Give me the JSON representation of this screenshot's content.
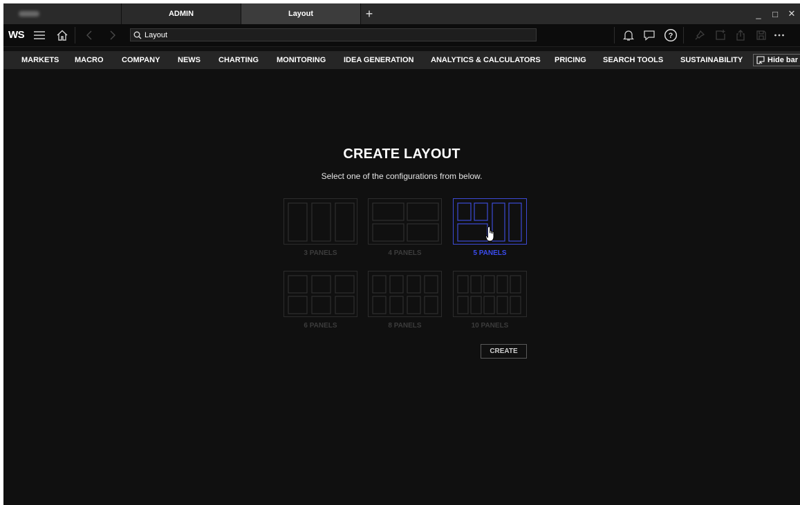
{
  "window": {
    "tabs": [
      {
        "label": ""
      },
      {
        "label": "ADMIN"
      },
      {
        "label": "Layout"
      }
    ],
    "new_tab_label": "+",
    "controls": {
      "minimize": "_",
      "maximize": "□",
      "close": "✕"
    }
  },
  "toolbar": {
    "logo": "WS",
    "icons": [
      "menu-icon",
      "home-icon",
      "back-icon",
      "forward-icon",
      "search-icon",
      "bell-icon",
      "chat-icon",
      "help-icon",
      "pin-icon",
      "new-window-icon",
      "export-icon",
      "save-icon",
      "more-icon"
    ],
    "search": {
      "value": "Layout",
      "placeholder": ""
    }
  },
  "menu": {
    "items": [
      "MARKETS",
      "MACRO",
      "COMPANY",
      "NEWS",
      "CHARTING",
      "MONITORING",
      "IDEA GENERATION",
      "ANALYTICS & CALCULATORS",
      "PRICING",
      "SEARCH TOOLS",
      "SUSTAINABILITY"
    ],
    "hide_bar_label": "Hide bar"
  },
  "main": {
    "title": "CREATE LAYOUT",
    "subtitle": "Select one of the configurations from below.",
    "options": [
      {
        "label": "3 PANELS",
        "selected": false
      },
      {
        "label": "4 PANELS",
        "selected": false
      },
      {
        "label": "5 PANELS",
        "selected": true
      },
      {
        "label": "6 PANELS",
        "selected": false
      },
      {
        "label": "8 PANELS",
        "selected": false
      },
      {
        "label": "10 PANELS",
        "selected": false
      }
    ],
    "create_label": "CREATE"
  },
  "colors": {
    "background": "#101010",
    "selected_accent": "#3b4cf0",
    "muted": "#3c3c3c",
    "titlebar": "#2a2a2a",
    "menubar": "#262626"
  }
}
